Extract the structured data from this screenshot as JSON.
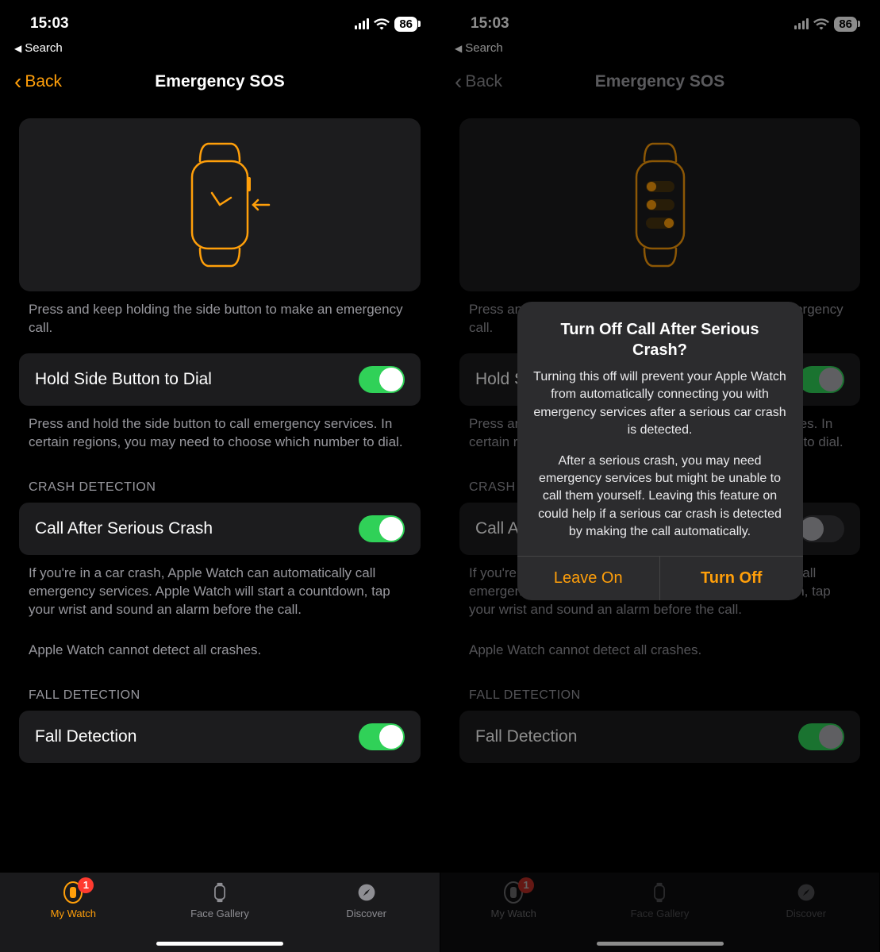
{
  "status": {
    "time": "15:03",
    "battery": "86"
  },
  "breadcrumb": {
    "label": "Search"
  },
  "nav": {
    "back": "Back",
    "title": "Emergency SOS"
  },
  "hero_footer": "Press and keep holding the side button to make an emergency call.",
  "settings": {
    "hold_side": {
      "label": "Hold Side Button to Dial",
      "footer": "Press and hold the side button to call emergency services. In certain regions, you may need to choose which number to dial."
    },
    "crash": {
      "header": "CRASH DETECTION",
      "label": "Call After Serious Crash",
      "footer": "If you're in a car crash, Apple Watch can automatically call emergency services. Apple Watch will start a countdown, tap your wrist and sound an alarm before the call.",
      "footer2": "Apple Watch cannot detect all crashes."
    },
    "fall": {
      "header": "FALL DETECTION",
      "label": "Fall Detection"
    }
  },
  "tabs": {
    "my_watch": "My Watch",
    "face_gallery": "Face Gallery",
    "discover": "Discover",
    "badge": "1"
  },
  "alert": {
    "title": "Turn Off Call After Serious Crash?",
    "msg1": "Turning this off will prevent your Apple Watch from automatically connecting you with emergency services after a serious car crash is detected.",
    "msg2": "After a serious crash, you may need emergency services but might be unable to call them yourself. Leaving this feature on could help if a serious car crash is detected by making the call automatically.",
    "leave_on": "Leave On",
    "turn_off": "Turn Off"
  }
}
